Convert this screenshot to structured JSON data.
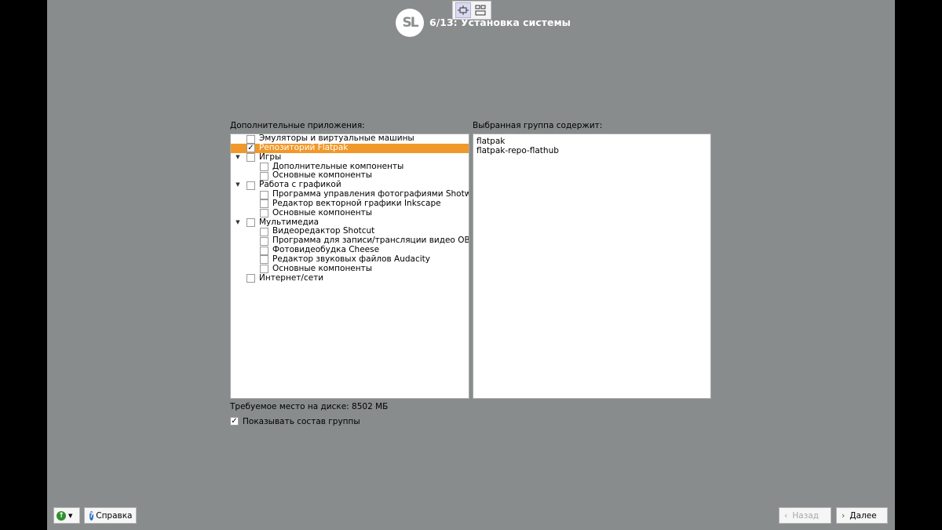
{
  "header": {
    "logo_text": "SL",
    "step_title": "6/13: Установка системы"
  },
  "left_pane": {
    "label": "Дополнительные приложения:",
    "tree": [
      {
        "level": 0,
        "arrow": "",
        "checked": false,
        "selected": false,
        "label": "Эмуляторы и виртуальные машины"
      },
      {
        "level": 0,
        "arrow": "",
        "checked": true,
        "selected": true,
        "label": "Репозиторий Flatpak"
      },
      {
        "level": 0,
        "arrow": "▼",
        "checked": false,
        "selected": false,
        "label": "Игры"
      },
      {
        "level": 1,
        "arrow": "",
        "checked": false,
        "selected": false,
        "label": "Дополнительные компоненты"
      },
      {
        "level": 1,
        "arrow": "",
        "checked": false,
        "selected": false,
        "label": "Основные компоненты"
      },
      {
        "level": 0,
        "arrow": "▼",
        "checked": false,
        "selected": false,
        "label": "Работа с графикой"
      },
      {
        "level": 1,
        "arrow": "",
        "checked": false,
        "selected": false,
        "label": "Программа управления фотографиями Shotwell"
      },
      {
        "level": 1,
        "arrow": "",
        "checked": false,
        "selected": false,
        "label": "Редактор векторной графики Inkscape"
      },
      {
        "level": 1,
        "arrow": "",
        "checked": false,
        "selected": false,
        "label": "Основные компоненты"
      },
      {
        "level": 0,
        "arrow": "▼",
        "checked": false,
        "selected": false,
        "label": "Мультимедиа"
      },
      {
        "level": 1,
        "arrow": "",
        "checked": false,
        "selected": false,
        "label": "Видеоредактор Shotcut"
      },
      {
        "level": 1,
        "arrow": "",
        "checked": false,
        "selected": false,
        "label": "Программа для записи/трансляции видео OBS S..."
      },
      {
        "level": 1,
        "arrow": "",
        "checked": false,
        "selected": false,
        "label": "Фотовидеобудка Cheese"
      },
      {
        "level": 1,
        "arrow": "",
        "checked": false,
        "selected": false,
        "label": "Редактор звуковых файлов Audacity"
      },
      {
        "level": 1,
        "arrow": "",
        "checked": false,
        "selected": false,
        "label": "Основные компоненты"
      },
      {
        "level": 0,
        "arrow": "",
        "checked": false,
        "selected": false,
        "label": "Интернет/сети"
      }
    ]
  },
  "right_pane": {
    "label": "Выбранная группа содержит:",
    "items": [
      "flatpak",
      "flatpak-repo-flathub"
    ]
  },
  "disk_space": "Требуемое место на диске: 8502 МБ",
  "show_group": {
    "checked": true,
    "label": "Показывать состав группы"
  },
  "buttons": {
    "help": "Справка",
    "back": "Назад",
    "next": "Далее"
  },
  "colors": {
    "background": "#888c8c",
    "selection": "#f0992a"
  }
}
